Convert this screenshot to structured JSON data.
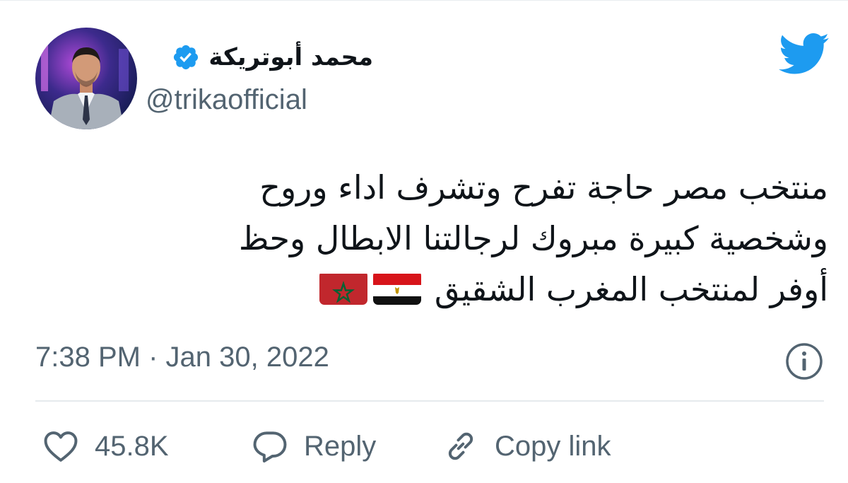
{
  "author": {
    "display_name": "محمد أبوتريكة",
    "handle": "@trikaofficial",
    "verified": true
  },
  "tweet": {
    "lines": [
      "منتخب مصر حاجة تفرح وتشرف اداء وروح",
      "وشخصية كبيرة مبروك لرجالتنا الابطال  وحظ",
      "أوفر لمنتخب المغرب الشقيق"
    ],
    "emoji_flags": [
      "egypt-flag",
      "morocco-flag"
    ]
  },
  "meta": {
    "time": "7:38 PM",
    "separator": "·",
    "date": "Jan 30, 2022"
  },
  "actions": {
    "like_count": "45.8K",
    "reply_label": "Reply",
    "copy_label": "Copy link"
  },
  "colors": {
    "twitter_blue": "#1d9bf0",
    "text_primary": "#0f1419",
    "text_secondary": "#536471",
    "divider": "#e6eaed"
  },
  "icons": {
    "brand": "twitter-bird-icon",
    "verified": "verified-badge-icon",
    "info": "info-icon",
    "like": "heart-icon",
    "reply": "speech-bubble-icon",
    "copy": "link-icon"
  }
}
